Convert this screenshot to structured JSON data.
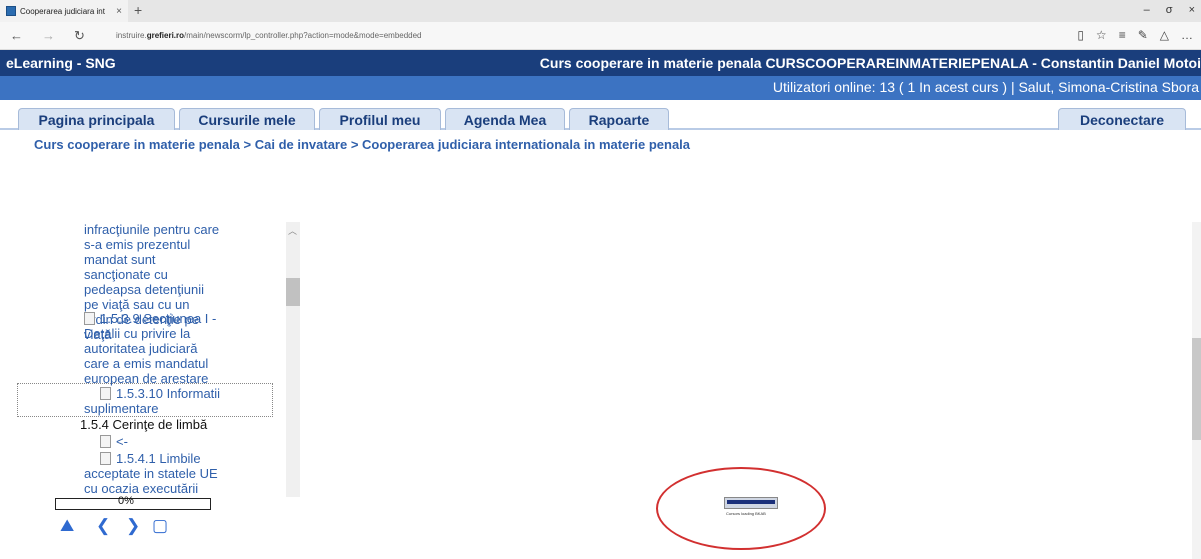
{
  "browser": {
    "tab_title": "Cooperarea judiciara int",
    "tab_close": "×",
    "new_tab": "+",
    "url_prefix": "instruire.",
    "url_domain": "grefieri.ro",
    "url_rest": "/main/newscorm/lp_controller.php?action=mode&mode=embedded",
    "win_min": "–",
    "win_max": "σ",
    "win_close": "×"
  },
  "header": {
    "brand": "eLearning - SNG",
    "course_title": "Curs cooperare in materie penala CURSCOOPERAREINMATERIEPENALA - Constantin Daniel Motoi",
    "online_text": "Utilizatori online:  13  ( 1 In acest curs  ) | Salut, Simona-Cristina Sbora"
  },
  "tabs": [
    "Pagina principala",
    "Cursurile mele",
    "Profilul meu",
    "Agenda Mea",
    "Rapoarte"
  ],
  "logout": "Deconectare",
  "breadcrumb": "Curs cooperare in materie penala > Cai de invatare > Cooperarea judiciara internationala in materie penala",
  "toc": {
    "item_a": [
      "infracţiunile pentru care",
      "s-a emis prezentul",
      "mandat sunt",
      "sancţionate cu",
      "pedeapsa detenţiunii",
      "pe viaţă sau cu un",
      "ordin de detenţie pe",
      "viaţă"
    ],
    "item_b": [
      "1.5.3.9 Secţiunea I -",
      "Detalii cu privire la",
      "autoritatea judiciară",
      "care a emis mandatul",
      "european de arestare"
    ],
    "item_c": [
      "1.5.3.10 Informatii",
      "suplimentare"
    ],
    "section": "1.5.4 Cerinţe de limbă",
    "item_d": "<-",
    "item_e": [
      "1.5.4.1 Limbile",
      "acceptate in statele UE",
      "cu ocazia executării"
    ]
  },
  "progress": {
    "label": "0%",
    "value": 0
  },
  "loader_label": "Cursors loading BKAB",
  "colors": {
    "header_dark": "#1a3e7c",
    "header_light": "#3c73c2",
    "link": "#2f5faa",
    "annotation": "#d23030"
  }
}
